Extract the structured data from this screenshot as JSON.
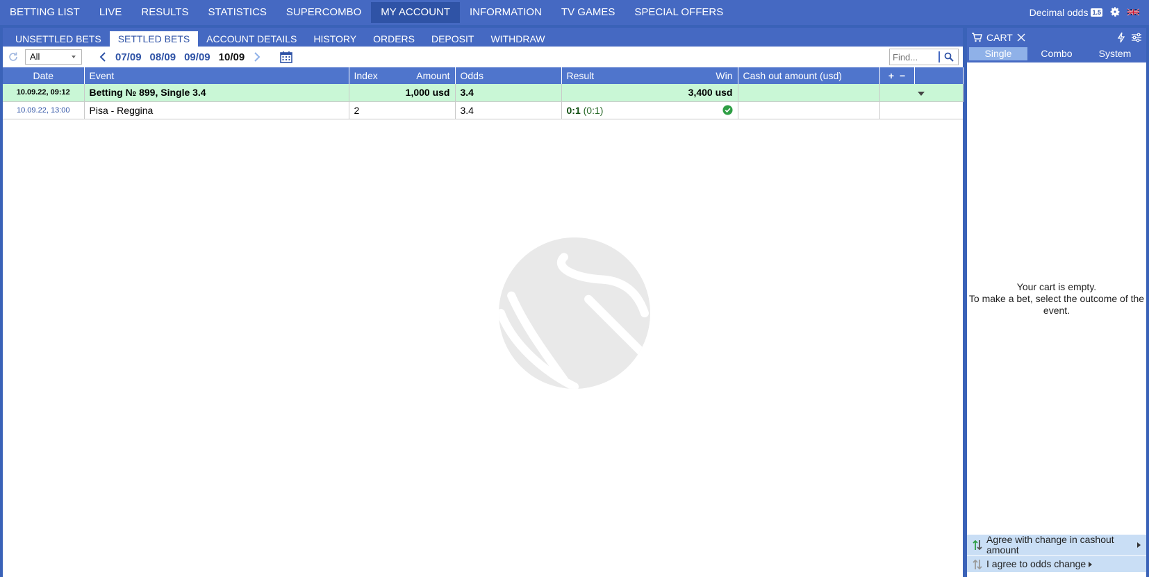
{
  "topnav": {
    "items": [
      "BETTING LIST",
      "LIVE",
      "RESULTS",
      "STATISTICS",
      "SUPERCOMBO",
      "MY ACCOUNT",
      "INFORMATION",
      "TV GAMES",
      "SPECIAL OFFERS"
    ],
    "active": "MY ACCOUNT",
    "odds_label": "Decimal odds",
    "odds_badge": "1.5"
  },
  "subtabs": {
    "items": [
      "UNSETTLED BETS",
      "SETTLED BETS",
      "ACCOUNT DETAILS",
      "HISTORY",
      "ORDERS",
      "DEPOSIT",
      "WITHDRAW"
    ],
    "active": "SETTLED BETS"
  },
  "toolbar": {
    "filter_value": "All",
    "dates": [
      "07/09",
      "08/09",
      "09/09",
      "10/09"
    ],
    "current_date": "10/09",
    "find_placeholder": "Find..."
  },
  "table": {
    "headers": {
      "date": "Date",
      "event": "Event",
      "index": "Index",
      "amount": "Amount",
      "odds": "Odds",
      "result": "Result",
      "win": "Win",
      "cashout": "Cash out amount (usd)",
      "plus": "+",
      "minus": "−"
    },
    "bet": {
      "date": "10.09.22,  09:12",
      "event": "Betting № 899, Single 3.4",
      "amount": "1,000 usd",
      "odds": "3.4",
      "win": "3,400 usd"
    },
    "event_row": {
      "date": "10.09.22, 13:00",
      "event": "Pisa - Reggina",
      "index": "2",
      "odds": "3.4",
      "score": "0:1",
      "half_score": "(0:1)"
    }
  },
  "cart": {
    "title": "CART",
    "tabs": [
      "Single",
      "Combo",
      "System"
    ],
    "active_tab": "Single",
    "empty_line1": "Your cart is empty.",
    "empty_line2": "To make a bet, select the outcome of the event.",
    "agree_cashout": "Agree with change in cashout amount",
    "agree_odds": "I agree to odds change"
  },
  "colors": {
    "brand_blue": "#4569c2",
    "header_blue": "#4f75cc",
    "bet_row_green": "#c9f7d6",
    "win_check": "#2e9e44"
  }
}
